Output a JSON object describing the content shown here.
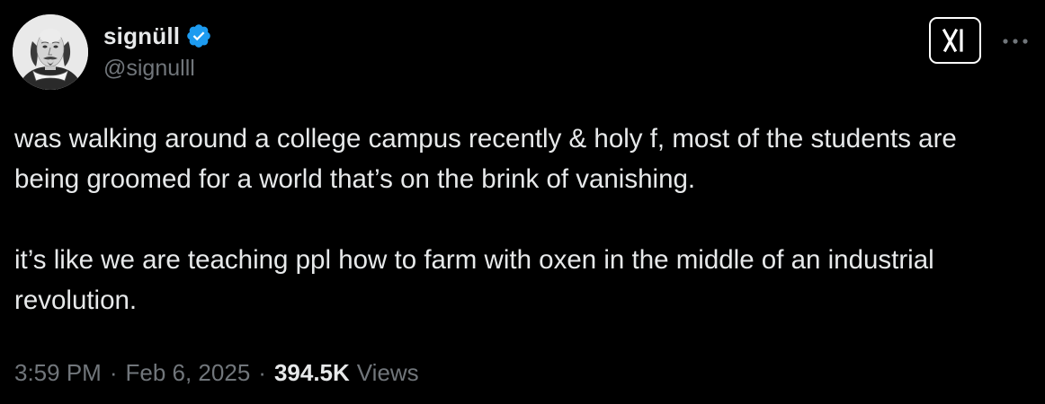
{
  "author": {
    "display_name": "signüll",
    "handle": "@signulll",
    "verified": true,
    "avatar_icon": "shakespeare-portrait-avatar"
  },
  "header_actions": {
    "grok_icon": "grok-logo-icon",
    "more_icon": "more-options-icon"
  },
  "tweet": {
    "paragraphs": [
      "was walking around a college campus recently & holy f, most of the students are being groomed for a world that’s on the brink of vanishing.",
      "it’s like we are teaching ppl how to farm with oxen in the middle of an industrial revolution."
    ],
    "time": "3:59 PM",
    "separator": "·",
    "date": "Feb 6, 2025",
    "views_count": "394.5K",
    "views_label": "Views"
  },
  "colors": {
    "background": "#000000",
    "text_primary": "#e7e9ea",
    "text_secondary": "#71767b",
    "verified_blue": "#1d9bf0"
  }
}
